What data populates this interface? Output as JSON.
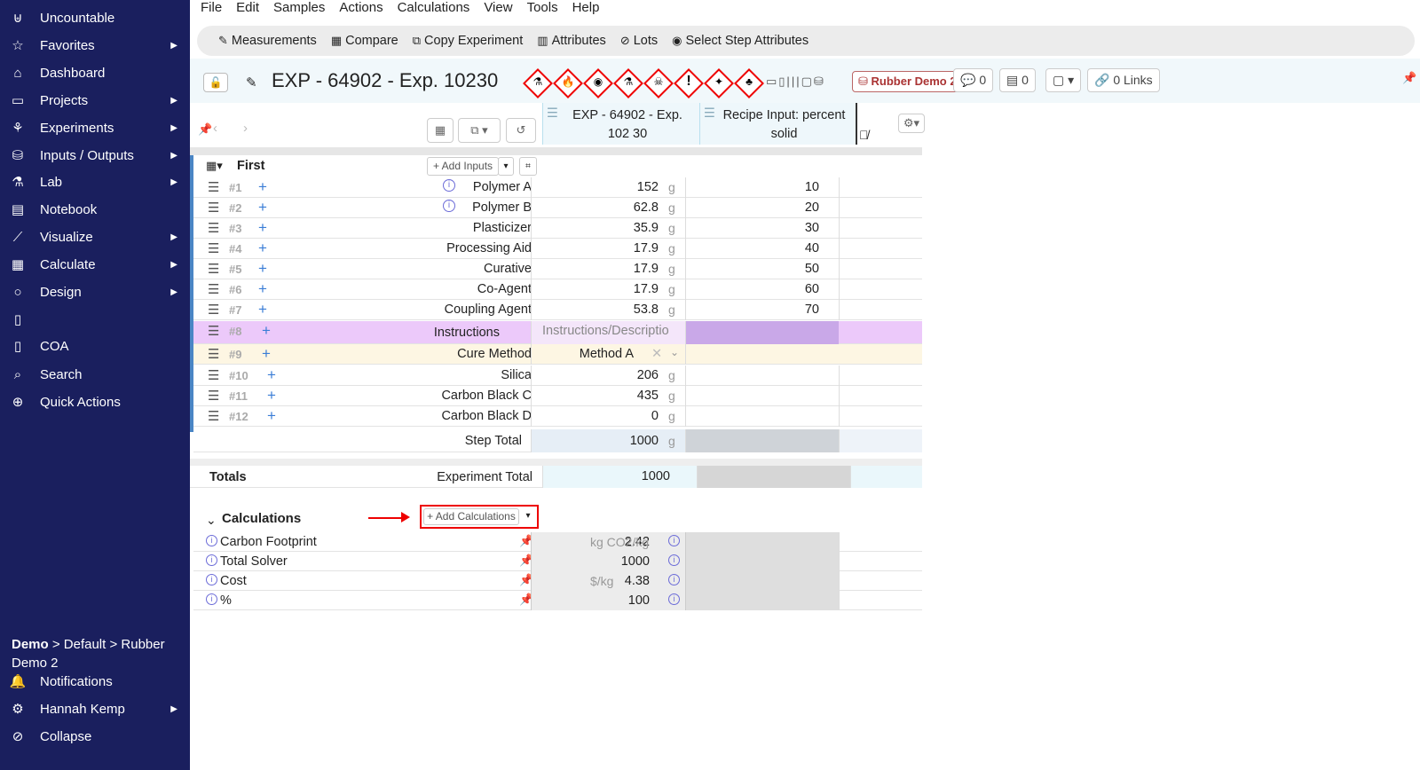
{
  "sidebar": {
    "items": [
      {
        "label": "Uncountable",
        "icon": "uncountable-logo-icon",
        "glyph": "⊎",
        "arrow": false
      },
      {
        "label": "Favorites",
        "icon": "star-icon",
        "glyph": "☆",
        "arrow": true
      },
      {
        "label": "Dashboard",
        "icon": "home-icon",
        "glyph": "⌂",
        "arrow": false
      },
      {
        "label": "Projects",
        "icon": "folder-icon",
        "glyph": "▭",
        "arrow": true
      },
      {
        "label": "Experiments",
        "icon": "network-icon",
        "glyph": "⚘",
        "arrow": true
      },
      {
        "label": "Inputs / Outputs",
        "icon": "boxes-icon",
        "glyph": "⛁",
        "arrow": true
      },
      {
        "label": "Lab",
        "icon": "flask-icon",
        "glyph": "⚗",
        "arrow": true
      },
      {
        "label": "Notebook",
        "icon": "notebook-icon",
        "glyph": "▤",
        "arrow": false
      },
      {
        "label": "Visualize",
        "icon": "chart-icon",
        "glyph": "⟋",
        "arrow": true
      },
      {
        "label": "Calculate",
        "icon": "calculator-icon",
        "glyph": "▦",
        "arrow": true
      },
      {
        "label": "Design",
        "icon": "lightbulb-icon",
        "glyph": "○",
        "arrow": true
      },
      {
        "label": "",
        "icon": "bookmark-icon",
        "glyph": "▯",
        "arrow": false
      },
      {
        "label": "COA",
        "icon": "bookmark-icon",
        "glyph": "▯",
        "arrow": false
      },
      {
        "label": "Search",
        "icon": "search-icon",
        "glyph": "⌕",
        "arrow": false
      },
      {
        "label": "Quick Actions",
        "icon": "quick-actions-icon",
        "glyph": "⊕",
        "arrow": false
      }
    ],
    "breadcrumb_bold": "Demo",
    "breadcrumb_rest": " > Default > Rubber Demo 2",
    "bottom": [
      {
        "label": "Notifications",
        "icon": "bell-icon",
        "glyph": "🔔",
        "arrow": false
      },
      {
        "label": "Hannah Kemp",
        "icon": "user-settings-icon",
        "glyph": "⚙",
        "arrow": true
      },
      {
        "label": "Collapse",
        "icon": "collapse-icon",
        "glyph": "⊘",
        "arrow": false
      }
    ]
  },
  "menu": [
    "File",
    "Edit",
    "Samples",
    "Actions",
    "Calculations",
    "View",
    "Tools",
    "Help"
  ],
  "toolbar": [
    {
      "label": "Measurements",
      "icon": "pencil-icon",
      "glyph": "✎"
    },
    {
      "label": "Compare",
      "icon": "table-icon",
      "glyph": "▦"
    },
    {
      "label": "Copy Experiment",
      "icon": "copy-icon",
      "glyph": "⧉"
    },
    {
      "label": "Attributes",
      "icon": "attributes-icon",
      "glyph": "▥"
    },
    {
      "label": "Lots",
      "icon": "lots-icon",
      "glyph": "⊘"
    },
    {
      "label": "Select Step Attributes",
      "icon": "target-icon",
      "glyph": "◉"
    }
  ],
  "title": "EXP - 64902 - Exp. 10230",
  "project_tag": "Rubber Demo 2",
  "comments_count": "0",
  "notes_count": "0",
  "links_label": "0 Links",
  "columns": {
    "exp": "EXP - 64902 - Exp. 102 30",
    "recipe": "Recipe Input: percent solid"
  },
  "section": {
    "name": "First",
    "add_inputs": "+ Add Inputs"
  },
  "rows": [
    {
      "num": "#1",
      "name": "Polymer A",
      "info": true,
      "value": "152",
      "unit": "g",
      "value2": "10"
    },
    {
      "num": "#2",
      "name": "Polymer B",
      "info": true,
      "value": "62.8",
      "unit": "g",
      "value2": "20"
    },
    {
      "num": "#3",
      "name": "Plasticizer",
      "info": false,
      "value": "35.9",
      "unit": "g",
      "value2": "30"
    },
    {
      "num": "#4",
      "name": "Processing Aid",
      "info": false,
      "value": "17.9",
      "unit": "g",
      "value2": "40"
    },
    {
      "num": "#5",
      "name": "Curative",
      "info": false,
      "value": "17.9",
      "unit": "g",
      "value2": "50"
    },
    {
      "num": "#6",
      "name": "Co-Agent",
      "info": false,
      "value": "17.9",
      "unit": "g",
      "value2": "60"
    },
    {
      "num": "#7",
      "name": "Coupling Agent",
      "info": false,
      "value": "53.8",
      "unit": "g",
      "value2": "70"
    }
  ],
  "instructions_row": {
    "num": "#8",
    "name": "Instructions",
    "placeholder": "Instructions/Descriptio"
  },
  "cure_row": {
    "num": "#9",
    "name": "Cure Method",
    "value": "Method A"
  },
  "rows2": [
    {
      "num": "#10",
      "name": "Silica",
      "value": "206",
      "unit": "g"
    },
    {
      "num": "#11",
      "name": "Carbon Black C",
      "value": "435",
      "unit": "g"
    },
    {
      "num": "#12",
      "name": "Carbon Black D",
      "value": "0",
      "unit": "g"
    }
  ],
  "step_total": {
    "label": "Step Total",
    "value": "1000",
    "unit": "g"
  },
  "totals": {
    "label": "Totals",
    "sub": "Experiment Total",
    "value": "1000"
  },
  "calculations": {
    "title": "Calculations",
    "add_label": "+ Add Calculations",
    "items": [
      {
        "name": "Carbon Footprint",
        "value": "2.42",
        "unit": "kg CO2/kg"
      },
      {
        "name": "Total Solver",
        "value": "1000",
        "unit": ""
      },
      {
        "name": "Cost",
        "value": "4.38",
        "unit": "$/kg"
      },
      {
        "name": "%",
        "value": "100",
        "unit": ""
      }
    ]
  },
  "colors": {
    "sidebar": "#1a1f5e",
    "accent": "#3a7dd6",
    "highlight_red": "#e00000",
    "instructions_row": "#ecc9fa",
    "cure_row": "#fdf6e3"
  }
}
